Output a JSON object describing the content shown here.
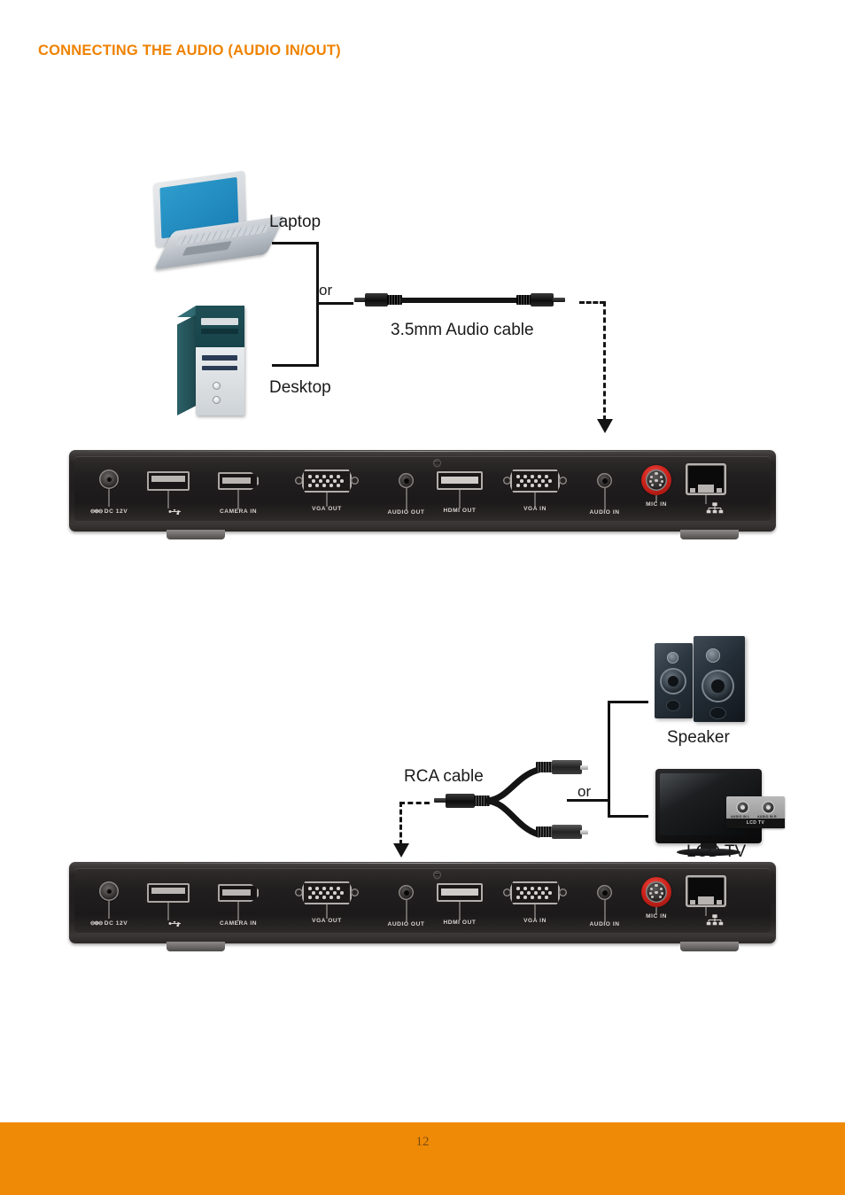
{
  "document": {
    "heading": "CONNECTING THE AUDIO (AUDIO IN/OUT)",
    "page_number": "12",
    "heading_color": "#ef8200",
    "footer_color": "#ef8a06"
  },
  "diagram_top": {
    "source_labels": {
      "laptop": "Laptop",
      "desktop": "Desktop",
      "or": "or"
    },
    "cable_label": "3.5mm Audio cable",
    "target_port": "AUDIO IN"
  },
  "diagram_bottom": {
    "cable_label": "RCA cable",
    "or": "or",
    "destination_labels": {
      "speaker": "Speaker",
      "tv": "LCD TV"
    },
    "tv_panel": {
      "left_jack": "AUDIO IN L",
      "right_jack": "AUDIO IN R",
      "brand_bar": "LCD TV"
    },
    "source_port": "AUDIO OUT"
  },
  "device_panel": {
    "ports": [
      {
        "id": "dc-in",
        "label": "DC 12V",
        "symbol": "⊖⊕⊖",
        "type": "barrel-jack"
      },
      {
        "id": "usb",
        "label": "",
        "symbol": "usb-icon",
        "type": "usb-a"
      },
      {
        "id": "camera-in",
        "label": "CAMERA IN",
        "symbol": "",
        "type": "hdmi-like"
      },
      {
        "id": "vga-out",
        "label": "VGA OUT",
        "symbol": "",
        "type": "vga-dsub"
      },
      {
        "id": "audio-out",
        "label": "AUDIO OUT",
        "symbol": "",
        "type": "3.5mm-jack"
      },
      {
        "id": "hdmi-out",
        "label": "HDMI OUT",
        "symbol": "",
        "type": "hdmi"
      },
      {
        "id": "vga-in",
        "label": "VGA IN",
        "symbol": "",
        "type": "vga-dsub"
      },
      {
        "id": "audio-in",
        "label": "AUDIO IN",
        "symbol": "",
        "type": "3.5mm-jack"
      },
      {
        "id": "mic-in",
        "label": "MIC IN",
        "symbol": "",
        "type": "mini-din",
        "highlight": "#d1241c"
      },
      {
        "id": "lan",
        "label": "",
        "symbol": "lan-icon",
        "type": "rj45"
      }
    ]
  }
}
